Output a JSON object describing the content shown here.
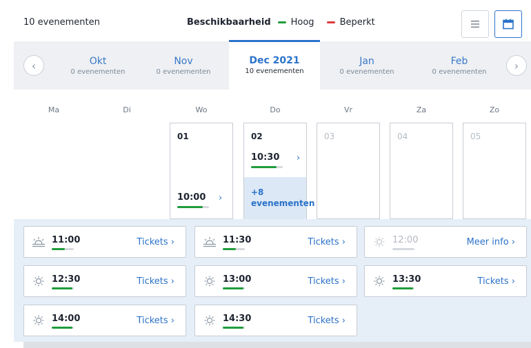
{
  "header": {
    "event_count": "10 evenementen",
    "availability_label": "Beschikbaarheid",
    "legend": [
      {
        "label": "Hoog",
        "color": "#1f9c3a"
      },
      {
        "label": "Beperkt",
        "color": "#e0393e"
      }
    ],
    "list_view_icon": "list-icon",
    "calendar_view_icon": "calendar-icon"
  },
  "months": [
    {
      "name": "Okt",
      "count": "0 evenementen"
    },
    {
      "name": "Nov",
      "count": "0 evenementen"
    },
    {
      "name": "Dec 2021",
      "count": "10 evenementen",
      "active": true
    },
    {
      "name": "Jan",
      "count": "0 evenementen"
    },
    {
      "name": "Feb",
      "count": "0 evenementen"
    }
  ],
  "weekdays": [
    "Ma",
    "Di",
    "Wo",
    "Do",
    "Vr",
    "Za",
    "Zo"
  ],
  "days": [
    {
      "num": "01",
      "slot_time": "10:00",
      "availability": 0.8
    },
    {
      "num": "02",
      "slot_time": "10:30",
      "availability": 0.8,
      "more": "+8 evenementen"
    },
    {
      "num": "03"
    },
    {
      "num": "04"
    },
    {
      "num": "05"
    }
  ],
  "slots": [
    {
      "time": "11:00",
      "link": "Tickets",
      "icon": "sunrise-icon",
      "availability": 0.6
    },
    {
      "time": "11:30",
      "link": "Tickets",
      "icon": "sunrise-icon",
      "availability": 0.6
    },
    {
      "time": "12:00",
      "link": "Meer info",
      "icon": "sun-icon",
      "availability": 0,
      "dim": true
    },
    {
      "time": "12:30",
      "link": "Tickets",
      "icon": "sun-icon",
      "availability": 0.95
    },
    {
      "time": "13:00",
      "link": "Tickets",
      "icon": "sun-icon",
      "availability": 0.95
    },
    {
      "time": "13:30",
      "link": "Tickets",
      "icon": "sun-icon",
      "availability": 0.95
    },
    {
      "time": "14:00",
      "link": "Tickets",
      "icon": "sun-icon",
      "availability": 0.95
    },
    {
      "time": "14:30",
      "link": "Tickets",
      "icon": "sun-icon",
      "availability": 0.95
    }
  ],
  "colors": {
    "accent": "#2b72c9",
    "high": "#1f9c3a",
    "limited": "#e0393e"
  }
}
